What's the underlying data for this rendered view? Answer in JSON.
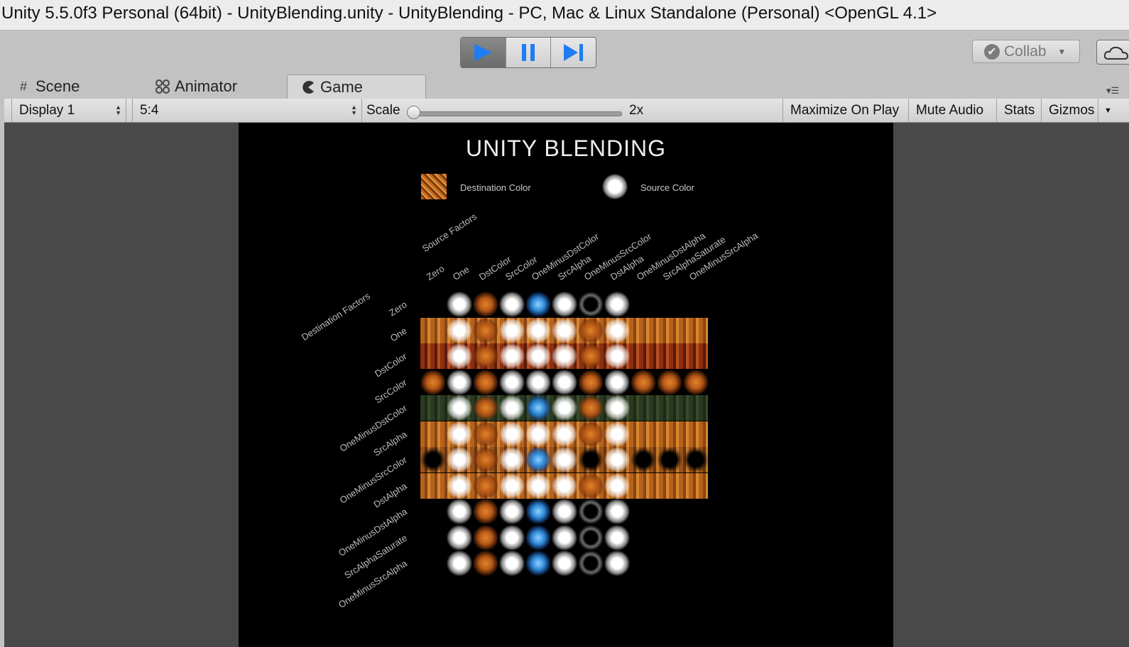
{
  "window": {
    "title": "Unity 5.5.0f3 Personal (64bit) - UnityBlending.unity - UnityBlending - PC, Mac & Linux Standalone (Personal) <OpenGL 4.1>"
  },
  "toolbar": {
    "collab_label": "Collab"
  },
  "tabs": [
    {
      "label": "Scene",
      "icon": "grid-icon"
    },
    {
      "label": "Animator",
      "icon": "animator-icon"
    },
    {
      "label": "Game",
      "icon": "pacman-icon"
    }
  ],
  "gamebar": {
    "display": "Display 1",
    "aspect": "5:4",
    "scale_label": "Scale",
    "scale_value": "2x",
    "scale_fraction": 0.0,
    "maximize": "Maximize On Play",
    "mute": "Mute Audio",
    "stats": "Stats",
    "gizmos": "Gizmos"
  },
  "game": {
    "title": "UNITY BLENDING",
    "destination_label": "Destination Color",
    "source_label": "Source Color",
    "source_factors_label": "Source Factors",
    "destination_factors_label": "Destination Factors",
    "source_factors": [
      "Zero",
      "One",
      "DstColor",
      "SrcColor",
      "OneMinusDstColor",
      "SrcAlpha",
      "OneMinusSrcColor",
      "DstAlpha",
      "OneMinusDstAlpha",
      "SrcAlphaSaturate",
      "OneMinusSrcAlpha"
    ],
    "destination_factors": [
      "Zero",
      "One",
      "DstColor",
      "SrcColor",
      "OneMinusDstColor",
      "SrcAlpha",
      "OneMinusSrcColor",
      "DstAlpha",
      "OneMinusDstAlpha",
      "SrcAlphaSaturate",
      "OneMinusSrcAlpha"
    ]
  }
}
